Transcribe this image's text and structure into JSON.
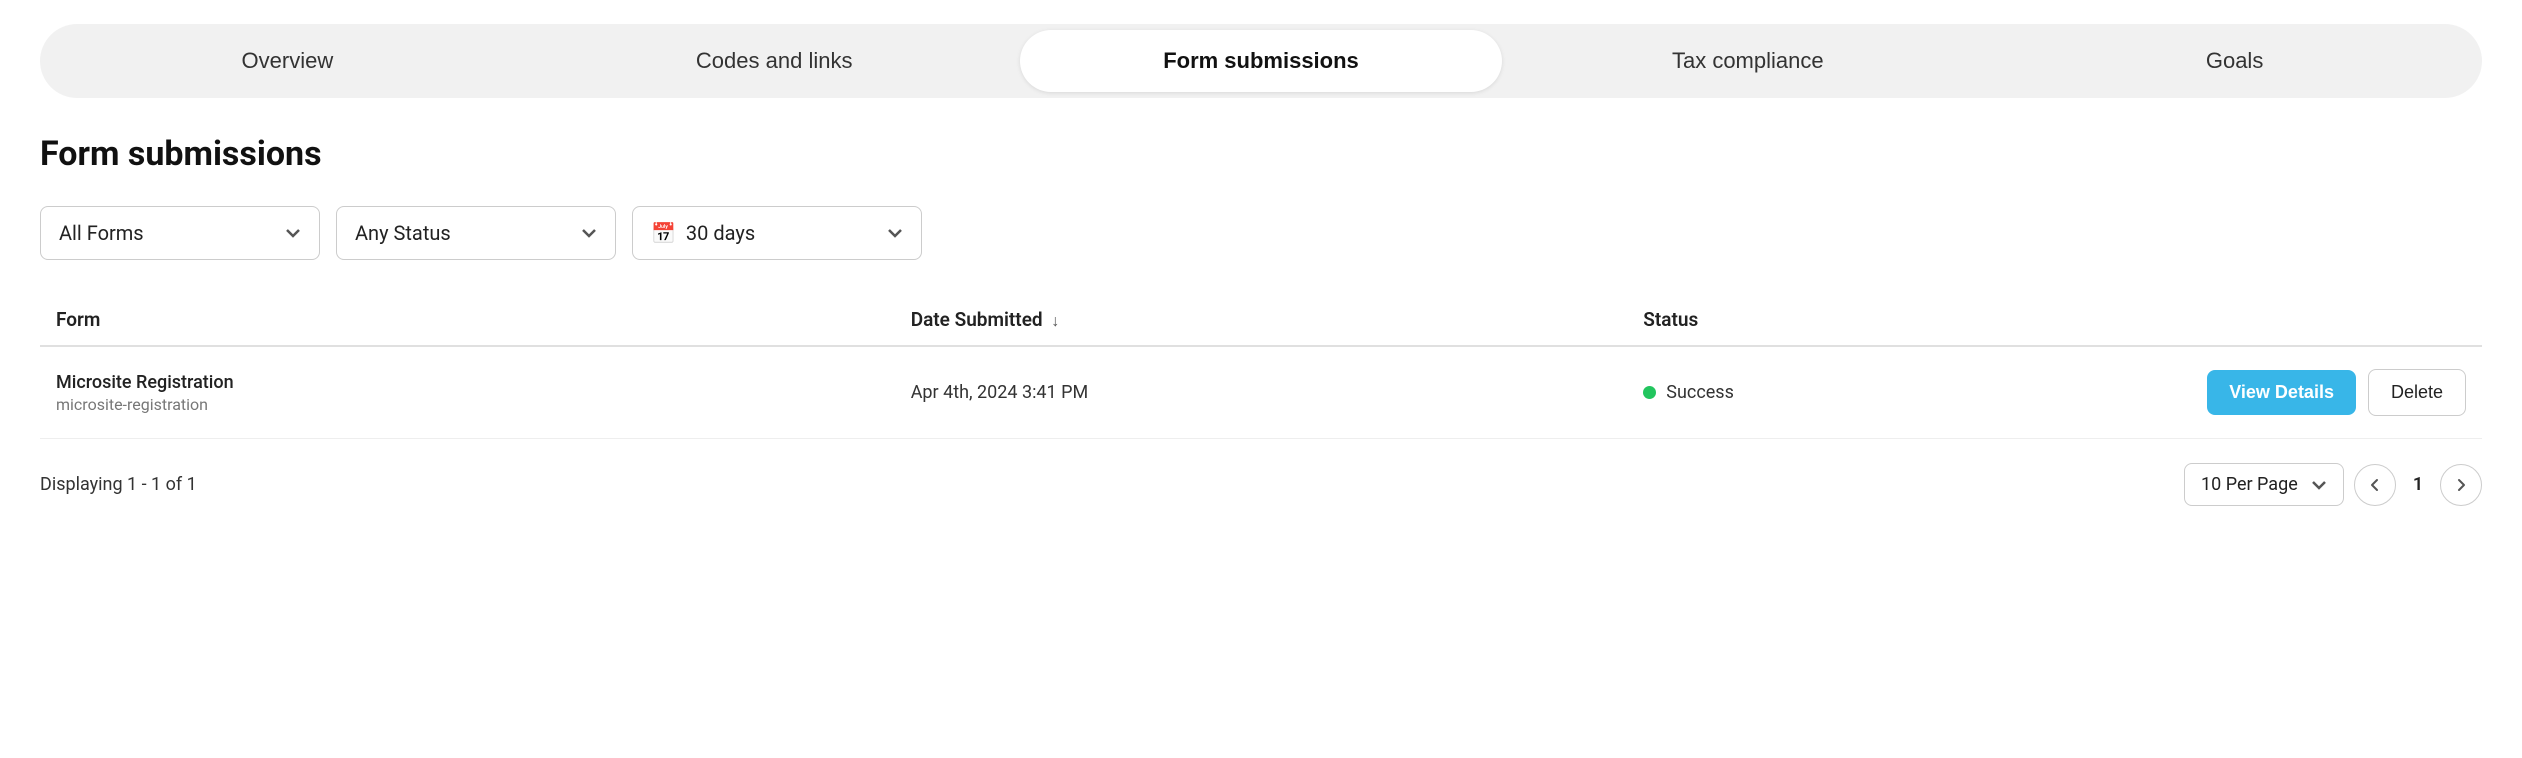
{
  "tabs": [
    {
      "id": "overview",
      "label": "Overview",
      "active": false
    },
    {
      "id": "codes-and-links",
      "label": "Codes and links",
      "active": false
    },
    {
      "id": "form-submissions",
      "label": "Form submissions",
      "active": true
    },
    {
      "id": "tax-compliance",
      "label": "Tax compliance",
      "active": false
    },
    {
      "id": "goals",
      "label": "Goals",
      "active": false
    }
  ],
  "page": {
    "title": "Form submissions"
  },
  "filters": {
    "form_label": "All Forms",
    "status_label": "Any Status",
    "date_label": "30 days"
  },
  "table": {
    "columns": [
      {
        "id": "form",
        "label": "Form"
      },
      {
        "id": "date_submitted",
        "label": "Date Submitted",
        "sortable": true,
        "sort_icon": "↓"
      },
      {
        "id": "status",
        "label": "Status"
      }
    ],
    "rows": [
      {
        "form_name": "Microsite Registration",
        "form_slug": "microsite-registration",
        "date_submitted": "Apr 4th, 2024 3:41 PM",
        "status": "Success",
        "status_color": "#22c55e"
      }
    ]
  },
  "buttons": {
    "view_details": "View Details",
    "delete": "Delete"
  },
  "footer": {
    "display_info": "Displaying 1 - 1 of 1",
    "per_page_label": "10 Per Page",
    "current_page": "1"
  }
}
